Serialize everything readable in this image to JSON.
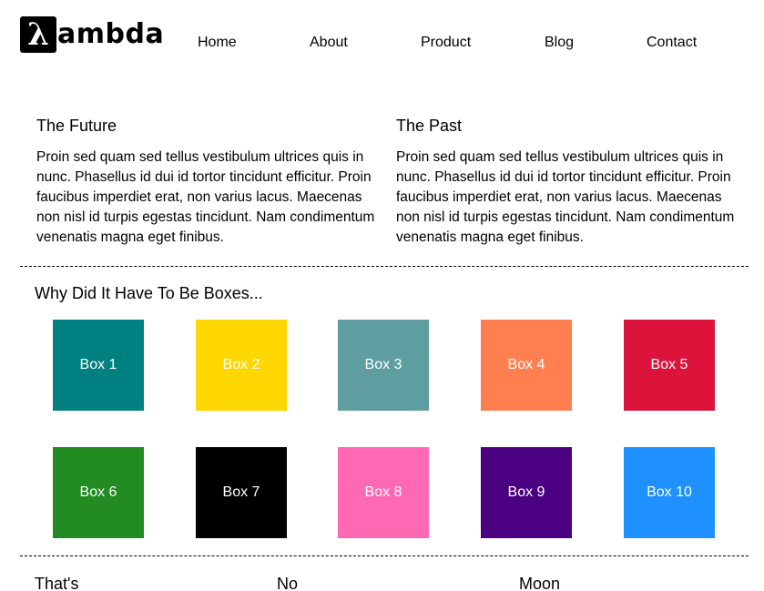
{
  "header": {
    "logo_mark": "λ",
    "logo_text": "ambda",
    "nav": [
      "Home",
      "About",
      "Product",
      "Blog",
      "Contact"
    ]
  },
  "columns": [
    {
      "title": "The Future",
      "body": "Proin sed quam sed tellus vestibulum ultrices quis in nunc. Phasellus id dui id tortor tincidunt efficitur. Proin faucibus imperdiet erat, non varius lacus. Maecenas non nisl id turpis egestas tincidunt. Nam condimentum venenatis magna eget finibus."
    },
    {
      "title": "The Past",
      "body": "Proin sed quam sed tellus vestibulum ultrices quis in nunc. Phasellus id dui id tortor tincidunt efficitur. Proin faucibus imperdiet erat, non varius lacus. Maecenas non nisl id turpis egestas tincidunt. Nam condimentum venenatis magna eget finibus."
    }
  ],
  "boxes_section": {
    "title": "Why Did It Have To Be Boxes...",
    "boxes": [
      {
        "label": "Box 1",
        "color": "#008080"
      },
      {
        "label": "Box 2",
        "color": "#FFD700"
      },
      {
        "label": "Box 3",
        "color": "#5F9EA0"
      },
      {
        "label": "Box 4",
        "color": "#FF7F50"
      },
      {
        "label": "Box 5",
        "color": "#DC143C"
      },
      {
        "label": "Box 6",
        "color": "#228B22"
      },
      {
        "label": "Box 7",
        "color": "#000000"
      },
      {
        "label": "Box 8",
        "color": "#FF69B4"
      },
      {
        "label": "Box 9",
        "color": "#4B0082"
      },
      {
        "label": "Box 10",
        "color": "#1E90FF"
      }
    ]
  },
  "footer_words": [
    "That's",
    "No",
    "Moon"
  ]
}
